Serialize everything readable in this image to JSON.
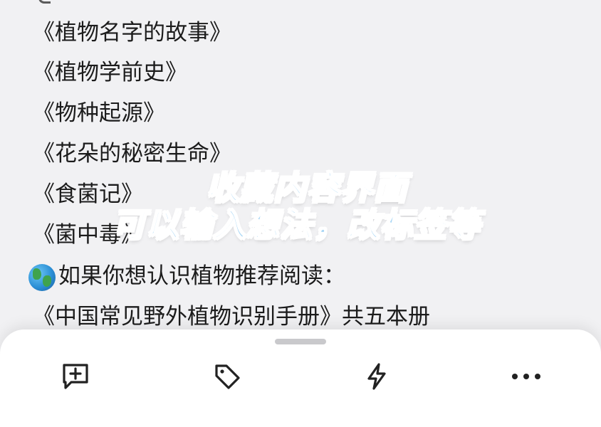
{
  "book_list": {
    "lines": [
      "《植物名字的故事》",
      "《植物学前史》",
      "《物种起源》",
      "《花朵的秘密生命》",
      "《食菌记》",
      "《菌中毒》"
    ],
    "recommend_heading": "如果你想认识植物推荐阅读：",
    "recommend_item": "《中国常见野外植物识别手册》共五本册"
  },
  "overlay": {
    "line1": "收藏内容界面",
    "line2": "可以输入想法，改标签等"
  },
  "bottom_sheet": {
    "actions": [
      {
        "icon": "add-note-icon"
      },
      {
        "icon": "tag-icon"
      },
      {
        "icon": "lightning-icon"
      },
      {
        "icon": "more-icon"
      }
    ]
  },
  "colors": {
    "background": "#f1f1f3",
    "sheet": "#ffffff",
    "text": "#1c1c1c",
    "overlay_fill": "#a8d6f5",
    "icon": "#222222"
  }
}
